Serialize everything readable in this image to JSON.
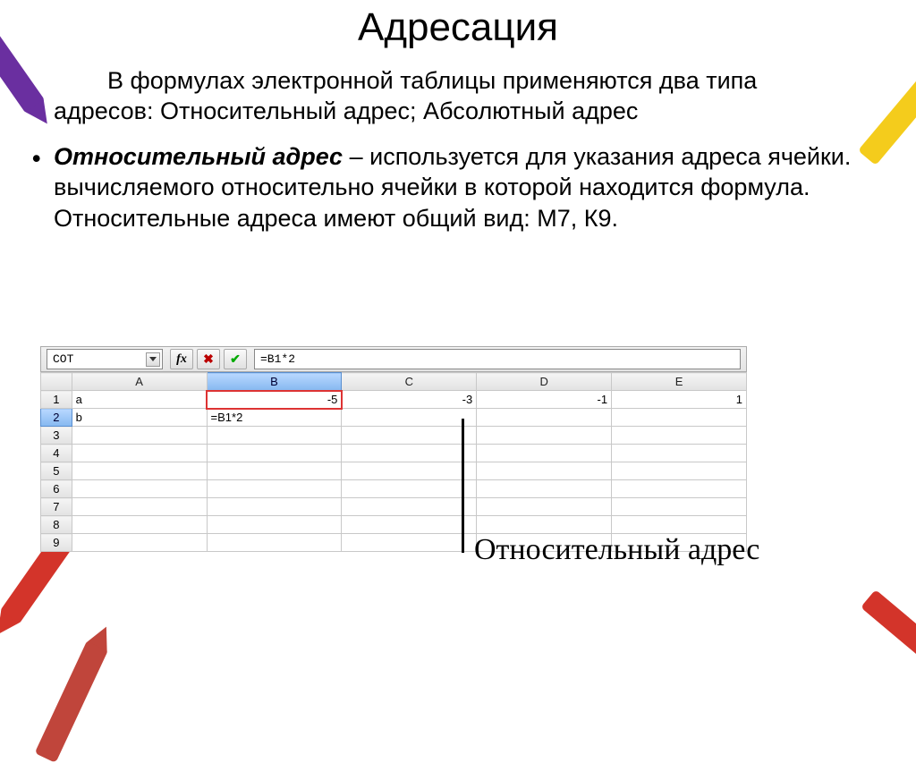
{
  "title": "Адресация",
  "intro": "В формулах электронной таблицы применяются два типа адресов:  Относительный адрес; Абсолютный адрес",
  "bullet": {
    "term": "Относительный адрес",
    "dash": " – ",
    "desc": "используется для указания адреса ячейки. вычисляемого относительно ячейки в которой находится формула. Относительные адреса имеют общий вид: М7, К9."
  },
  "spreadsheet": {
    "name_box": "COT",
    "fx_label": "fx",
    "cancel_glyph": "✖",
    "accept_glyph": "✔",
    "formula": "=B1*2",
    "columns": [
      "A",
      "B",
      "C",
      "D",
      "E"
    ],
    "rows": [
      "1",
      "2",
      "3",
      "4",
      "5",
      "6",
      "7",
      "8",
      "9"
    ],
    "cells": {
      "r1": {
        "A": "a",
        "B": "-5",
        "C": "-3",
        "D": "-1",
        "E": "1"
      },
      "r2": {
        "A": "b",
        "B": "=B1*2"
      }
    }
  },
  "callout": "Относительный адрес"
}
